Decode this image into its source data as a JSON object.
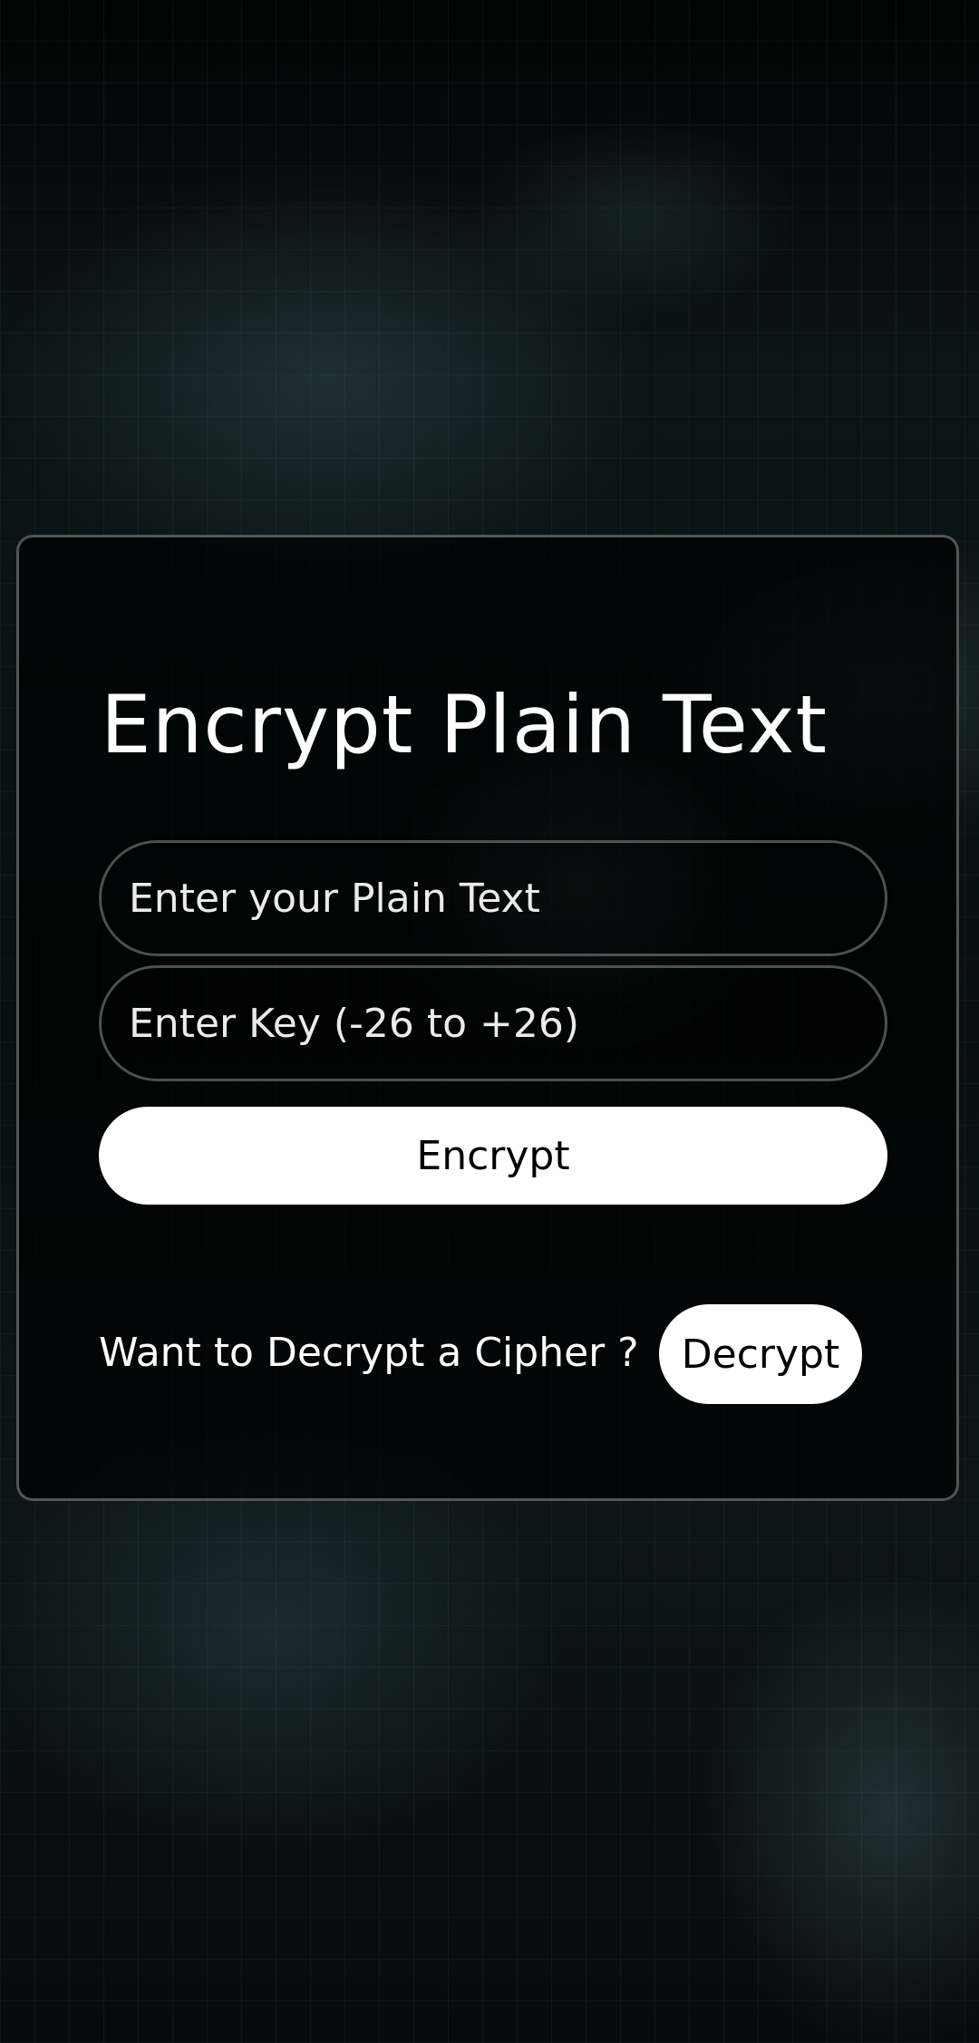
{
  "app": {
    "title": "Encrypt Plain Text"
  },
  "form": {
    "plain_text_placeholder": "Enter your Plain Text",
    "plain_text_value": "",
    "key_placeholder": "Enter Key (-26 to +26)",
    "key_value": "",
    "encrypt_label": "Encrypt"
  },
  "footer": {
    "prompt": "Want to Decrypt a Cipher ?",
    "decrypt_label": "Decrypt"
  },
  "theme": {
    "background": "#05080a",
    "card_border": "#969696",
    "button_bg": "#ffffff",
    "button_text": "#000000",
    "text": "#ffffff"
  }
}
